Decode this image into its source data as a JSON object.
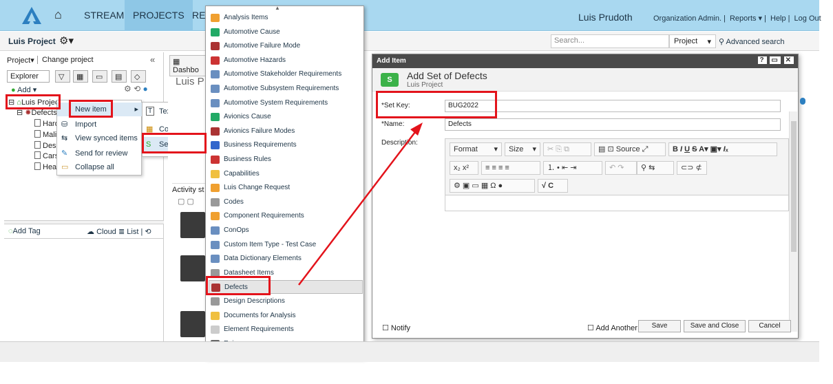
{
  "topbar": {
    "nav": [
      "STREAM",
      "PROJECTS",
      "REV"
    ],
    "user": "Luis Prudoth",
    "links": [
      "Organization Admin.",
      "Reports ▾",
      "Help",
      "Log Out"
    ]
  },
  "subbar": {
    "project": "Luis Project",
    "search_placeholder": "Search...",
    "scope": "Project",
    "advanced": "Advanced search"
  },
  "left": {
    "project_menu": "Project▾",
    "change_project": "Change project",
    "explorer_tab": "Explorer",
    "add": "Add ▾",
    "root": "Luis Project",
    "defects": "Defects",
    "children": [
      "Hard",
      "Malic",
      "Desi",
      "Cars",
      "Head"
    ],
    "add_tag": "Add Tag",
    "cloud": "Cloud",
    "list": "List"
  },
  "context_menu": [
    "New item",
    "Import",
    "View synced items",
    "Send for review",
    "Collapse all"
  ],
  "submenu": [
    "Text",
    "Component",
    "Set of..."
  ],
  "mid": {
    "dash_tab": "Dashbo",
    "title": "Luis P",
    "activity": "Activity st"
  },
  "item_types": [
    "Analysis Items",
    "Automotive Cause",
    "Automotive Failure Mode",
    "Automotive Hazards",
    "Automotive Stakeholder Requirements",
    "Automotive Subsystem Requirements",
    "Automotive System Requirements",
    "Avionics Cause",
    "Avionics Failure Modes",
    "Business Requirements",
    "Business Rules",
    "Capabilities",
    "Luis Change Request",
    "Codes",
    "Component Requirements",
    "ConOps",
    "Custom Item Type - Test Case",
    "Data Dictionary Elements",
    "Datasheet Items",
    "Defects",
    "Design Descriptions",
    "Documents for Analysis",
    "Element Requirements",
    "Epics"
  ],
  "dialog": {
    "header": "Add Item",
    "title": "Add Set of Defects",
    "subtitle": "Luis Project",
    "set_key_label": "*Set Key:",
    "set_key_value": "BUG2022",
    "name_label": "*Name:",
    "name_value": "Defects",
    "description_label": "Description:",
    "format": "Format",
    "size": "Size",
    "source": "Source",
    "notify": "Notify",
    "add_another": "Add Another",
    "save": "Save",
    "save_close": "Save and Close",
    "cancel": "Cancel"
  },
  "colors": {
    "accent": "#e3131b",
    "topbar": "#a9d8f0",
    "link": "#1d3446"
  }
}
